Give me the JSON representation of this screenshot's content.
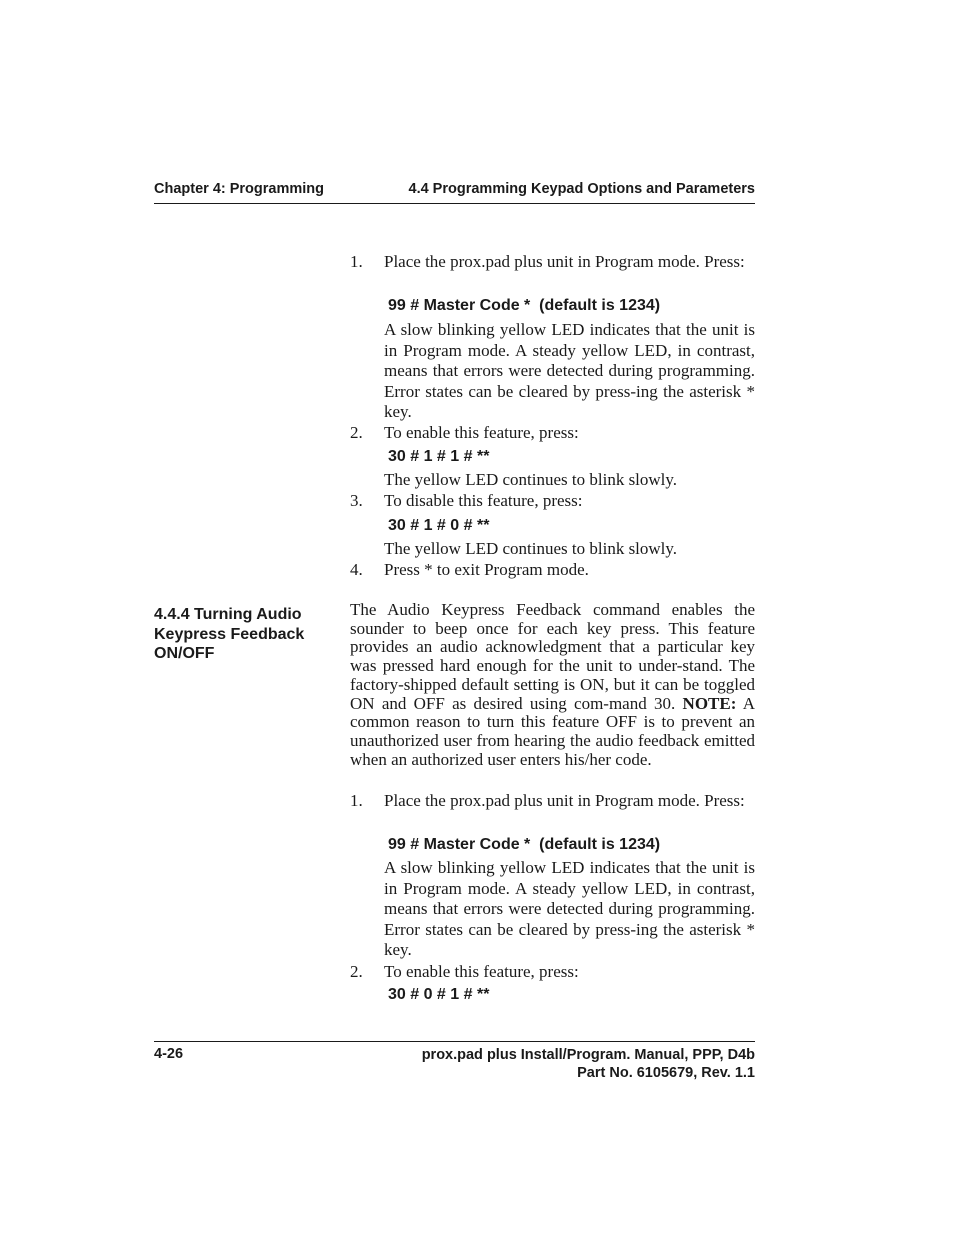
{
  "header": {
    "chapter": "Chapter 4: Programming",
    "section": "4.4 Programming Keypad Options and Parameters"
  },
  "section_a": {
    "steps": [
      {
        "number": "1.",
        "text": "Place the prox.pad plus unit in Program mode. Press:",
        "command": "99 # Master Code *  (default is 1234)",
        "note": "A slow blinking yellow LED indicates that the unit is in Program mode. A steady yellow LED, in contrast, means that errors were detected during programming. Error states can be cleared by press-ing the asterisk * key."
      },
      {
        "number": "2.",
        "text": "To enable this feature, press:",
        "command": "30 # 1 # 1 # **",
        "note": "The yellow LED continues to blink slowly."
      },
      {
        "number": "3.",
        "text": "To disable this feature, press:",
        "command": "30 # 1 # 0 # **",
        "note": "The yellow LED continues to blink slowly."
      },
      {
        "number": "4.",
        "text": "Press * to exit Program mode."
      }
    ]
  },
  "section_b": {
    "heading": "4.4.4 Turning Audio Keypress Feedback ON/OFF",
    "intro_before_note": "The Audio Keypress Feedback command enables the sounder to beep once for each key press. This feature provides an audio acknowledgment that a particular key was pressed hard enough for the unit to under-stand. The factory-shipped default setting is ON, but it can be toggled ON and OFF as desired using com-mand 30. ",
    "note_label": "NOTE:",
    "intro_after_note": " A common reason to turn this feature OFF is to prevent an unauthorized user from hearing the audio feedback emitted when an authorized user enters his/her code.",
    "steps": [
      {
        "number": "1.",
        "text": "Place the prox.pad plus unit in Program mode. Press:",
        "command": "99 # Master Code *  (default is 1234)",
        "note": "A slow blinking yellow LED indicates that the unit is in Program mode. A steady yellow LED, in contrast, means that errors were detected during programming. Error states can be cleared by press-ing the asterisk * key."
      },
      {
        "number": "2.",
        "text": "To enable this feature, press:",
        "command": "30 # 0 # 1 # **"
      }
    ]
  },
  "footer": {
    "page_number": "4-26",
    "manual_title": "prox.pad plus Install/Program. Manual, PPP, D4b",
    "part_number": "Part No. 6105679, Rev. 1.1"
  }
}
